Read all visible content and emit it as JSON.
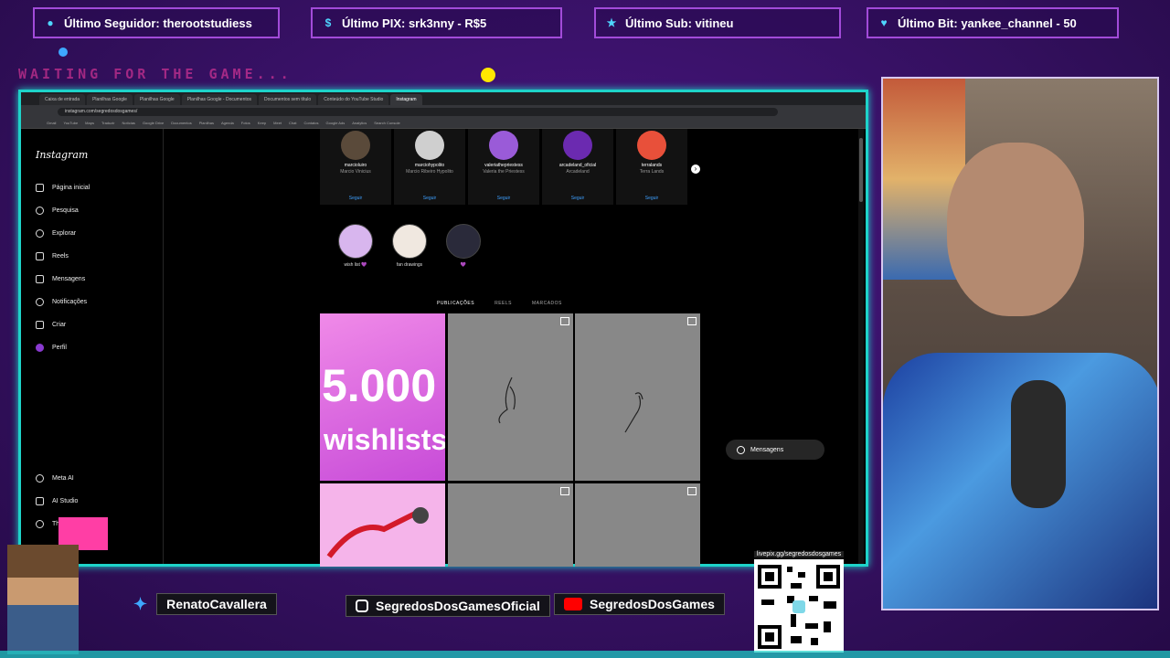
{
  "overlay": {
    "follower": "Último Seguidor: therootstudiess",
    "pix": "Último PIX: srk3nny - R$5",
    "sub": "Último Sub: vitineu",
    "bit": "Último Bit: yankee_channel - 50",
    "waiting": "WAITING FOR THE GAME..."
  },
  "browser": {
    "tabs": [
      "Caixa de entrada",
      "Planilhas Google",
      "Planilhas Google",
      "Planilhas Google - Documentos",
      "Documentos sem título",
      "Conteúdo do YouTube Studio",
      "Instagram"
    ],
    "url": "instagram.com/segredosdosgames/",
    "bookmarks": [
      "Gmail",
      "YouTube",
      "Maps",
      "Traduzir",
      "Notícias",
      "Google Drive",
      "Documentos",
      "Planilhas",
      "Agenda",
      "Fotos",
      "Keep",
      "Meet",
      "Chat",
      "Contatos",
      "Google Ads",
      "Analytics",
      "Search Console"
    ]
  },
  "instagram": {
    "logo": "Instagram",
    "nav": [
      "Página inicial",
      "Pesquisa",
      "Explorar",
      "Reels",
      "Mensagens",
      "Notificações",
      "Criar",
      "Perfil"
    ],
    "nav_bottom": [
      "Meta AI",
      "AI Studio",
      "Threads"
    ],
    "suggestions": [
      {
        "user": "marcioluiro",
        "name": "Marcio Vinicius",
        "follow": "Seguir"
      },
      {
        "user": "marciohypolito",
        "name": "Marcio Ribeiro Hypolito",
        "follow": "Seguir"
      },
      {
        "user": "valeriathepriestess",
        "name": "Valeria the Priestess",
        "follow": "Seguir"
      },
      {
        "user": "arcadeland_oficial",
        "name": "Arcadeland",
        "follow": "Seguir"
      },
      {
        "user": "terralands",
        "name": "Terra Lands",
        "follow": "Seguir"
      }
    ],
    "highlights": [
      "wish list 💜",
      "fan drawings",
      "💜"
    ],
    "profile_tabs": [
      "PUBLICAÇÕES",
      "REELS",
      "MARCADOS"
    ],
    "post1_text_top": "5.000",
    "post1_text_bottom": "wishlists",
    "messages": "Mensagens"
  },
  "socials": {
    "twitter": "RenatoCavallera",
    "instagram": "SegredosDosGamesOficial",
    "youtube": "SegredosDosGames",
    "qr_link": "livepix.gg/segredosdosgames"
  },
  "colors": {
    "accent_cyan": "#1ed3c9",
    "purple_bg": "#3a0f6b",
    "pink": "#ff3ea5"
  }
}
